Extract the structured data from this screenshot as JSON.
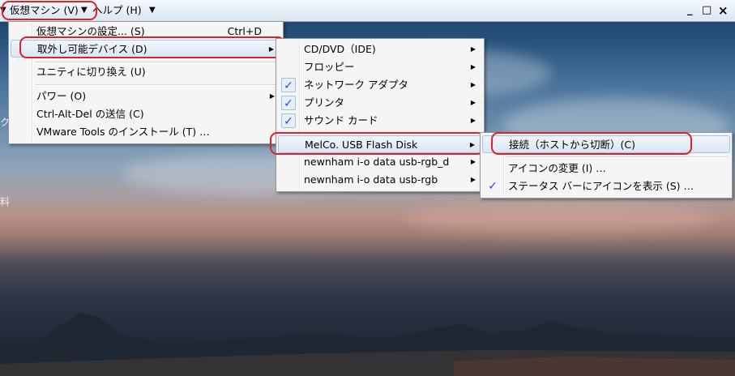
{
  "menubar": {
    "vm_menu": "仮想マシン (V)",
    "help_menu": "ヘルプ (H)",
    "arrow": "▼",
    "minimize": "_",
    "maximize": "□",
    "close": "×"
  },
  "desktop_fragments": [
    "ク",
    "料"
  ],
  "vm_menu": {
    "items": [
      {
        "label": "仮想マシンの設定... (S)",
        "shortcut": "Ctrl+D"
      },
      {
        "label": "取外し可能デバイス (D)"
      },
      {
        "label": "ユニティに切り換え (U)"
      },
      {
        "label": "パワー (O)"
      },
      {
        "label": "Ctrl-Alt-Del の送信 (C)"
      },
      {
        "label": "VMware Tools のインストール (T) …"
      }
    ]
  },
  "devices_menu": {
    "items": [
      {
        "label": "CD/DVD（IDE)",
        "checked": false
      },
      {
        "label": "フロッピー",
        "checked": false
      },
      {
        "label": "ネットワーク アダプタ",
        "checked": true
      },
      {
        "label": "プリンタ",
        "checked": true
      },
      {
        "label": "サウンド カード",
        "checked": true
      },
      {
        "label": "MelCo. USB Flash Disk",
        "checked": false
      },
      {
        "label": "newnham i-o data usb-rgb_d",
        "checked": false
      },
      {
        "label": "newnham i-o data usb-rgb",
        "checked": false
      }
    ]
  },
  "usb_menu": {
    "items": [
      {
        "label": "接続（ホストから切断）(C)",
        "checked": false
      },
      {
        "label": "アイコンの変更 (I) …",
        "checked": false
      },
      {
        "label": "ステータス バーにアイコンを表示 (S) …",
        "checked": true
      }
    ]
  },
  "glyphs": {
    "submenu": "▶",
    "check": "✓"
  },
  "colors": {
    "highlight_ring": "#e0202a",
    "check": "#1a4fd6"
  }
}
